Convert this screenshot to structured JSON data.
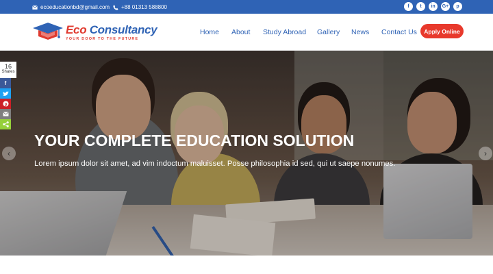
{
  "topbar": {
    "email": "ecoeducationbd@gmail.com",
    "phone": "+88 01313 588800",
    "socials": [
      {
        "icon": "facebook-icon",
        "glyph": "f"
      },
      {
        "icon": "twitter-icon",
        "glyph": "t"
      },
      {
        "icon": "linkedin-icon",
        "glyph": "in"
      },
      {
        "icon": "googleplus-icon",
        "glyph": "G+"
      },
      {
        "icon": "pinterest-icon",
        "glyph": "p"
      }
    ]
  },
  "logo": {
    "title_eco": "Eco",
    "title_rest": " Consultancy",
    "tagline": "YOUR DOOR TO THE FUTURE"
  },
  "nav": {
    "home": "Home",
    "about": "About",
    "study_abroad": "Study Abroad",
    "gallery": "Gallery",
    "news": "News",
    "contact": "Contact Us",
    "apply": "Apply Online"
  },
  "hero": {
    "title": "YOUR COMPLETE EDUCATION SOLUTION",
    "text": "Lorem ipsum dolor sit amet, ad vim indoctum maluisset. Posse philosophia id sed, qui ut saepe nonumes."
  },
  "share": {
    "count": "16",
    "label": "Shares"
  },
  "colors": {
    "brand_blue": "#2f63b5",
    "accent_red": "#e8392c"
  }
}
